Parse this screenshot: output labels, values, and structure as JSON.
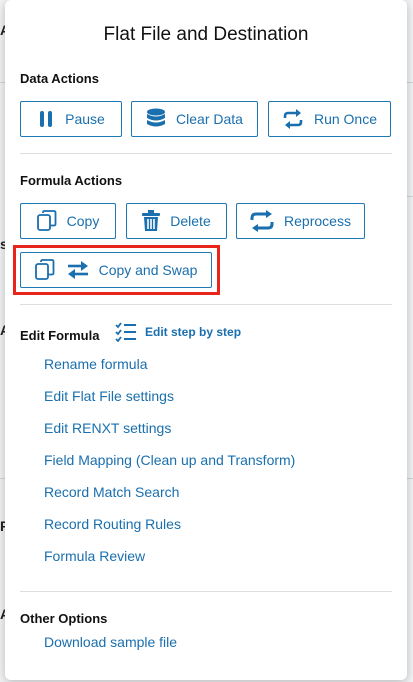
{
  "popup": {
    "title": "Flat File and Destination"
  },
  "background": {
    "letters": [
      "A",
      "s",
      "A",
      "F",
      "A"
    ]
  },
  "data_actions": {
    "heading": "Data Actions",
    "pause_label": "Pause",
    "clear_label": "Clear Data",
    "run_once_label": "Run Once"
  },
  "formula_actions": {
    "heading": "Formula Actions",
    "copy_label": "Copy",
    "delete_label": "Delete",
    "reprocess_label": "Reprocess",
    "copy_swap_label": "Copy and Swap"
  },
  "edit_formula": {
    "heading": "Edit Formula",
    "step_by_step_label": "Edit step by step",
    "links": [
      "Rename formula",
      "Edit Flat File settings",
      "Edit RENXT settings",
      "Field Mapping (Clean up and Transform)",
      "Record Match Search",
      "Record Routing Rules",
      "Formula Review"
    ]
  },
  "other_options": {
    "heading": "Other Options",
    "download_label": "Download sample file"
  },
  "colors": {
    "accent": "#1a6fae",
    "highlight": "#e8241b"
  }
}
